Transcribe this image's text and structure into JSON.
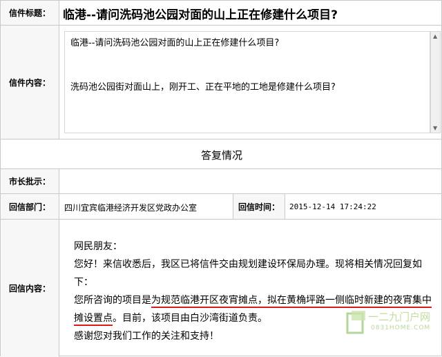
{
  "letter": {
    "title_label": "信件标题：",
    "title": "临港--请问洗码池公园对面的山上正在修建什么项目?",
    "content_label": "信件内容：",
    "content_line1": "临港--请问洗码池公园对面的山上正在修建什么项目?",
    "content_line2": "洗码池公园街对面山上，刚开工、正在平地的工地是修建什么项目?"
  },
  "reply": {
    "section_title": "答复情况",
    "mayor_label": "市长批示：",
    "dept_label": "回信部门：",
    "dept": "四川宜宾临港经济开发区党政办公室",
    "time_label": "回信时间：",
    "time": "2015-12-14 17:24:22",
    "content_label": "回信内容：",
    "greeting": "网民朋友：",
    "p1": "您好！来信收悉后，我区已将信件交由规划建设环保局办理。现将相关情况回复如下：",
    "p2_a": "您所咨询的项目是",
    "p2_u1": "为规范临港开区夜宵摊点，拟在黄桷坪路一侧临时新建的",
    "p2_u2": "夜宵集中摊设置点",
    "p2_b": "。目前，该项目由白沙湾街道负责。",
    "p3": "感谢您对我们工作的关注和支持！"
  },
  "watermark": {
    "name": "一二九门户网",
    "url": "0831HOME.COM"
  },
  "colors": {
    "underline": "#d41c1c",
    "label_bg": "#f7f7f7",
    "border": "#c8c8c8"
  }
}
